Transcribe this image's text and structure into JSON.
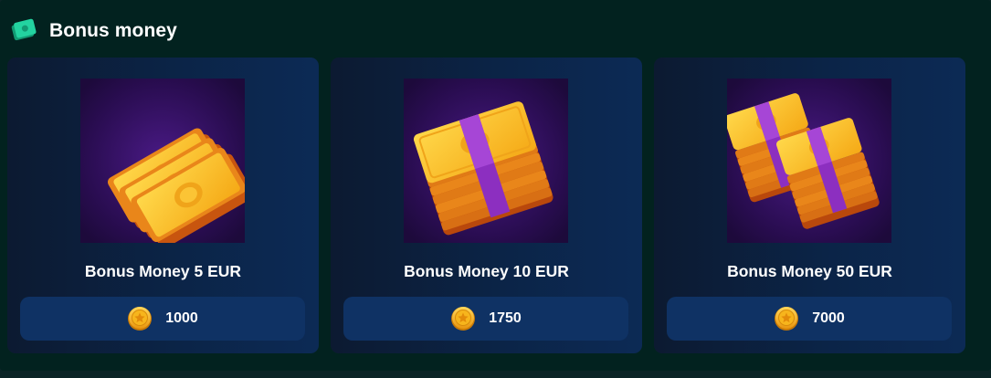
{
  "section": {
    "title": "Bonus money",
    "icon": "cash-icon",
    "accent": "#23d3a0"
  },
  "cards": [
    {
      "title": "Bonus Money 5 EUR",
      "price": "1000",
      "image": "loose-banknotes-icon",
      "coin_icon": "star-coin-icon"
    },
    {
      "title": "Bonus Money 10 EUR",
      "price": "1750",
      "image": "banknote-stack-icon",
      "coin_icon": "star-coin-icon"
    },
    {
      "title": "Bonus Money 50 EUR",
      "price": "7000",
      "image": "double-banknote-stack-icon",
      "coin_icon": "star-coin-icon"
    }
  ],
  "colors": {
    "background": "#02221f",
    "card": "#0b2447",
    "price_button": "#0f3264",
    "banknote": "#f5b51c",
    "band": "#9a34c9",
    "image_bg": "#2a0d52"
  }
}
